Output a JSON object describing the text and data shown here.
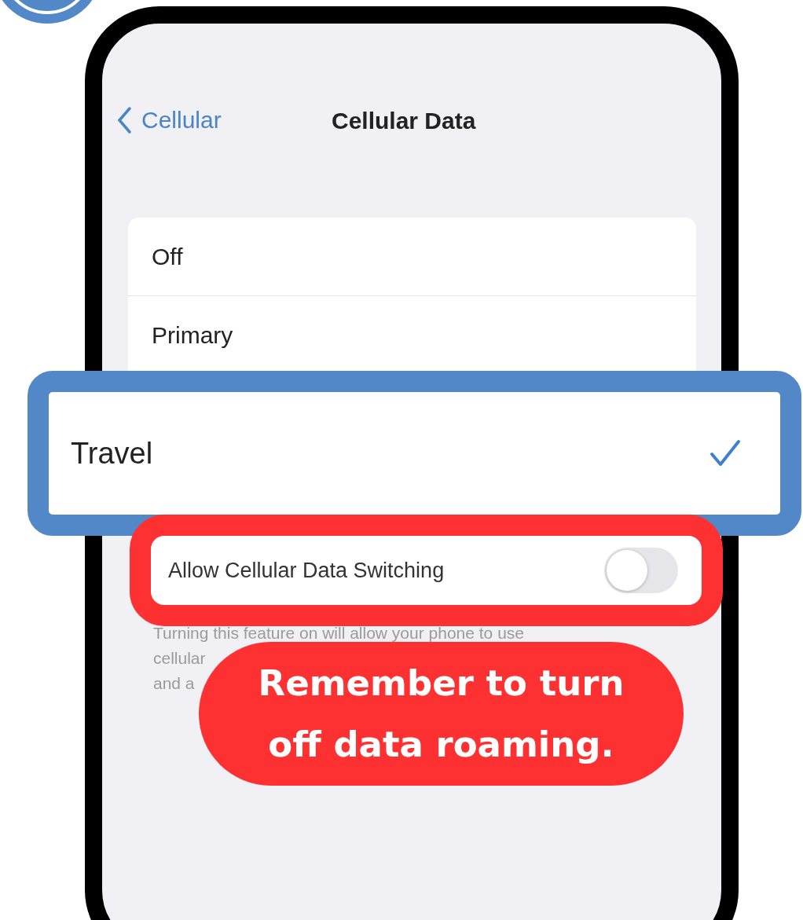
{
  "nav": {
    "back": "Cellular",
    "title": "Cellular Data"
  },
  "options": [
    {
      "label": "Off",
      "selected": false
    },
    {
      "label": "Primary",
      "selected": false
    },
    {
      "label": "Travel",
      "selected": true
    }
  ],
  "switching": {
    "label": "Allow Cellular Data Switching",
    "on": false
  },
  "footnote": [
    "Turning this feature on will allow your phone to use",
    "cellular",
    "and a"
  ],
  "callout": {
    "lines": [
      "Remember to turn",
      "off data roaming."
    ]
  }
}
